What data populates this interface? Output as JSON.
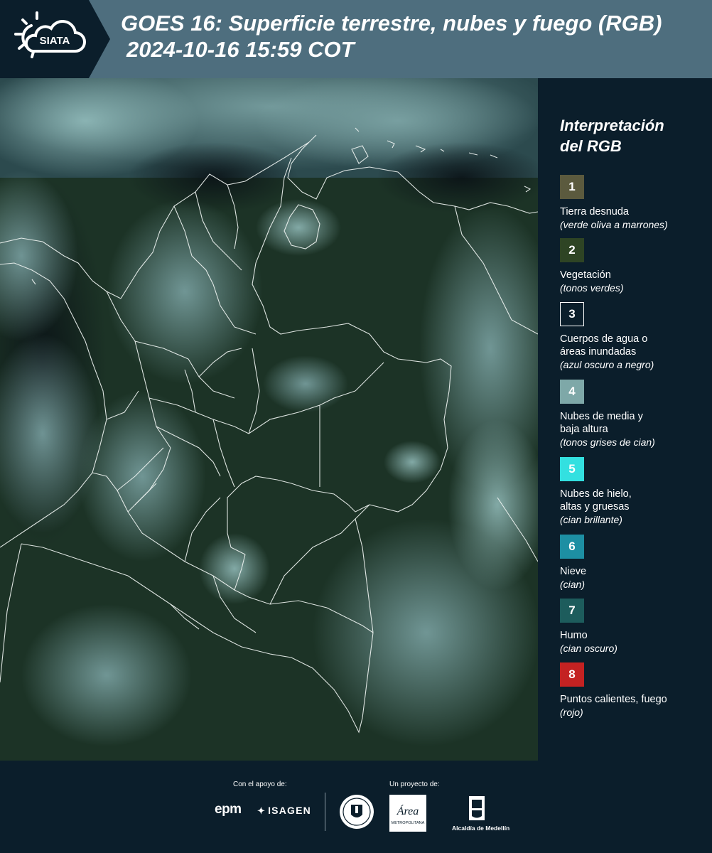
{
  "header": {
    "logo_text": "SIATA",
    "title_line1": "GOES 16: Superficie terrestre, nubes y fuego (RGB)",
    "title_line2": "2024-10-16 15:59 COT"
  },
  "legend": {
    "title_line1": "Interpretación",
    "title_line2": "del RGB",
    "items": [
      {
        "number": "1",
        "color": "#5b5a3e",
        "label": "Tierra desnuda",
        "sub": "(verde oliva a marrones)"
      },
      {
        "number": "2",
        "color": "#2e4424",
        "label": "Vegetación",
        "sub": "(tonos verdes)"
      },
      {
        "number": "3",
        "color": "#0b1e2b",
        "label": "Cuerpos de agua o",
        "label2": "áreas inundadas",
        "sub": "(azul oscuro a negro)"
      },
      {
        "number": "4",
        "color": "#7ea8a8",
        "label": "Nubes de media y",
        "label2": "baja altura",
        "sub": "(tonos grises de cian)"
      },
      {
        "number": "5",
        "color": "#33e0e0",
        "label": "Nubes de hielo,",
        "label2": "altas y gruesas",
        "sub": "(cian brillante)"
      },
      {
        "number": "6",
        "color": "#1d8fa3",
        "label": "Nieve",
        "sub": "(cian)"
      },
      {
        "number": "7",
        "color": "#1d5c5c",
        "label": "Humo",
        "sub": "(cian oscuro)"
      },
      {
        "number": "8",
        "color": "#c42222",
        "label": "Puntos calientes, fuego",
        "sub": "(rojo)"
      }
    ]
  },
  "footer": {
    "support_label": "Con el apoyo de:",
    "project_label": "Un proyecto de:",
    "epm": "epm",
    "isagen": "ISAGEN",
    "area_text": "Área",
    "area_sub": "METROPOLITANA",
    "alcaldia": "Alcaldía de Medellín"
  }
}
